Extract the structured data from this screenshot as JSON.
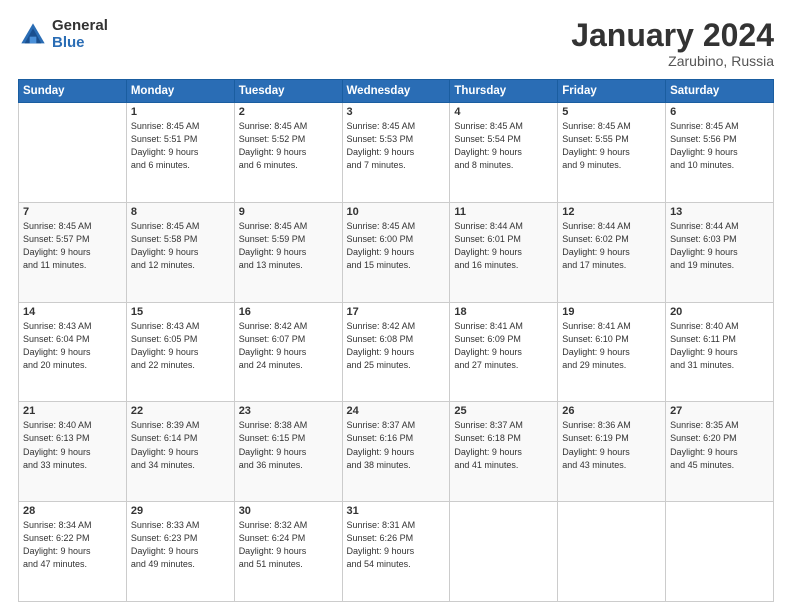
{
  "header": {
    "logo_general": "General",
    "logo_blue": "Blue",
    "month_title": "January 2024",
    "location": "Zarubino, Russia"
  },
  "weekdays": [
    "Sunday",
    "Monday",
    "Tuesday",
    "Wednesday",
    "Thursday",
    "Friday",
    "Saturday"
  ],
  "weeks": [
    [
      {
        "day": "",
        "sunrise": "",
        "sunset": "",
        "daylight": ""
      },
      {
        "day": "1",
        "sunrise": "Sunrise: 8:45 AM",
        "sunset": "Sunset: 5:51 PM",
        "daylight": "Daylight: 9 hours and 6 minutes."
      },
      {
        "day": "2",
        "sunrise": "Sunrise: 8:45 AM",
        "sunset": "Sunset: 5:52 PM",
        "daylight": "Daylight: 9 hours and 6 minutes."
      },
      {
        "day": "3",
        "sunrise": "Sunrise: 8:45 AM",
        "sunset": "Sunset: 5:53 PM",
        "daylight": "Daylight: 9 hours and 7 minutes."
      },
      {
        "day": "4",
        "sunrise": "Sunrise: 8:45 AM",
        "sunset": "Sunset: 5:54 PM",
        "daylight": "Daylight: 9 hours and 8 minutes."
      },
      {
        "day": "5",
        "sunrise": "Sunrise: 8:45 AM",
        "sunset": "Sunset: 5:55 PM",
        "daylight": "Daylight: 9 hours and 9 minutes."
      },
      {
        "day": "6",
        "sunrise": "Sunrise: 8:45 AM",
        "sunset": "Sunset: 5:56 PM",
        "daylight": "Daylight: 9 hours and 10 minutes."
      }
    ],
    [
      {
        "day": "7",
        "sunrise": "Sunrise: 8:45 AM",
        "sunset": "Sunset: 5:57 PM",
        "daylight": "Daylight: 9 hours and 11 minutes."
      },
      {
        "day": "8",
        "sunrise": "Sunrise: 8:45 AM",
        "sunset": "Sunset: 5:58 PM",
        "daylight": "Daylight: 9 hours and 12 minutes."
      },
      {
        "day": "9",
        "sunrise": "Sunrise: 8:45 AM",
        "sunset": "Sunset: 5:59 PM",
        "daylight": "Daylight: 9 hours and 13 minutes."
      },
      {
        "day": "10",
        "sunrise": "Sunrise: 8:45 AM",
        "sunset": "Sunset: 6:00 PM",
        "daylight": "Daylight: 9 hours and 15 minutes."
      },
      {
        "day": "11",
        "sunrise": "Sunrise: 8:44 AM",
        "sunset": "Sunset: 6:01 PM",
        "daylight": "Daylight: 9 hours and 16 minutes."
      },
      {
        "day": "12",
        "sunrise": "Sunrise: 8:44 AM",
        "sunset": "Sunset: 6:02 PM",
        "daylight": "Daylight: 9 hours and 17 minutes."
      },
      {
        "day": "13",
        "sunrise": "Sunrise: 8:44 AM",
        "sunset": "Sunset: 6:03 PM",
        "daylight": "Daylight: 9 hours and 19 minutes."
      }
    ],
    [
      {
        "day": "14",
        "sunrise": "Sunrise: 8:43 AM",
        "sunset": "Sunset: 6:04 PM",
        "daylight": "Daylight: 9 hours and 20 minutes."
      },
      {
        "day": "15",
        "sunrise": "Sunrise: 8:43 AM",
        "sunset": "Sunset: 6:05 PM",
        "daylight": "Daylight: 9 hours and 22 minutes."
      },
      {
        "day": "16",
        "sunrise": "Sunrise: 8:42 AM",
        "sunset": "Sunset: 6:07 PM",
        "daylight": "Daylight: 9 hours and 24 minutes."
      },
      {
        "day": "17",
        "sunrise": "Sunrise: 8:42 AM",
        "sunset": "Sunset: 6:08 PM",
        "daylight": "Daylight: 9 hours and 25 minutes."
      },
      {
        "day": "18",
        "sunrise": "Sunrise: 8:41 AM",
        "sunset": "Sunset: 6:09 PM",
        "daylight": "Daylight: 9 hours and 27 minutes."
      },
      {
        "day": "19",
        "sunrise": "Sunrise: 8:41 AM",
        "sunset": "Sunset: 6:10 PM",
        "daylight": "Daylight: 9 hours and 29 minutes."
      },
      {
        "day": "20",
        "sunrise": "Sunrise: 8:40 AM",
        "sunset": "Sunset: 6:11 PM",
        "daylight": "Daylight: 9 hours and 31 minutes."
      }
    ],
    [
      {
        "day": "21",
        "sunrise": "Sunrise: 8:40 AM",
        "sunset": "Sunset: 6:13 PM",
        "daylight": "Daylight: 9 hours and 33 minutes."
      },
      {
        "day": "22",
        "sunrise": "Sunrise: 8:39 AM",
        "sunset": "Sunset: 6:14 PM",
        "daylight": "Daylight: 9 hours and 34 minutes."
      },
      {
        "day": "23",
        "sunrise": "Sunrise: 8:38 AM",
        "sunset": "Sunset: 6:15 PM",
        "daylight": "Daylight: 9 hours and 36 minutes."
      },
      {
        "day": "24",
        "sunrise": "Sunrise: 8:37 AM",
        "sunset": "Sunset: 6:16 PM",
        "daylight": "Daylight: 9 hours and 38 minutes."
      },
      {
        "day": "25",
        "sunrise": "Sunrise: 8:37 AM",
        "sunset": "Sunset: 6:18 PM",
        "daylight": "Daylight: 9 hours and 41 minutes."
      },
      {
        "day": "26",
        "sunrise": "Sunrise: 8:36 AM",
        "sunset": "Sunset: 6:19 PM",
        "daylight": "Daylight: 9 hours and 43 minutes."
      },
      {
        "day": "27",
        "sunrise": "Sunrise: 8:35 AM",
        "sunset": "Sunset: 6:20 PM",
        "daylight": "Daylight: 9 hours and 45 minutes."
      }
    ],
    [
      {
        "day": "28",
        "sunrise": "Sunrise: 8:34 AM",
        "sunset": "Sunset: 6:22 PM",
        "daylight": "Daylight: 9 hours and 47 minutes."
      },
      {
        "day": "29",
        "sunrise": "Sunrise: 8:33 AM",
        "sunset": "Sunset: 6:23 PM",
        "daylight": "Daylight: 9 hours and 49 minutes."
      },
      {
        "day": "30",
        "sunrise": "Sunrise: 8:32 AM",
        "sunset": "Sunset: 6:24 PM",
        "daylight": "Daylight: 9 hours and 51 minutes."
      },
      {
        "day": "31",
        "sunrise": "Sunrise: 8:31 AM",
        "sunset": "Sunset: 6:26 PM",
        "daylight": "Daylight: 9 hours and 54 minutes."
      },
      {
        "day": "",
        "sunrise": "",
        "sunset": "",
        "daylight": ""
      },
      {
        "day": "",
        "sunrise": "",
        "sunset": "",
        "daylight": ""
      },
      {
        "day": "",
        "sunrise": "",
        "sunset": "",
        "daylight": ""
      }
    ]
  ]
}
